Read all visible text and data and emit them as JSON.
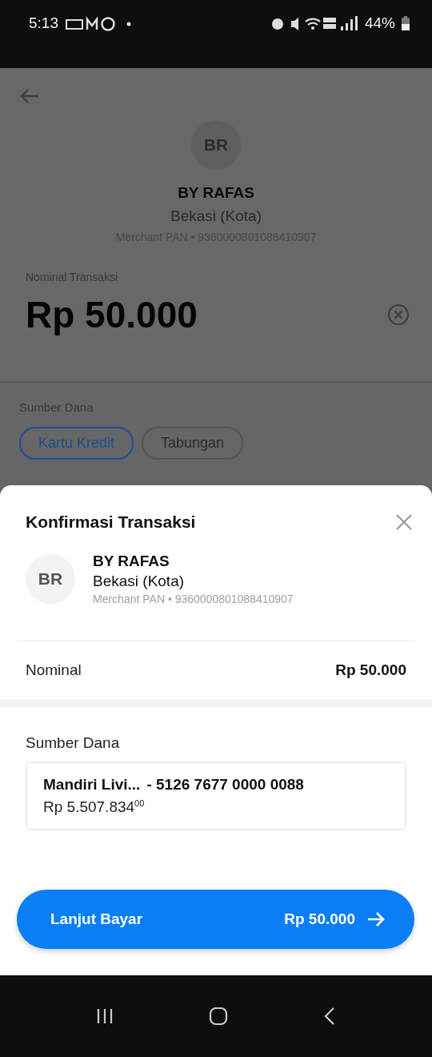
{
  "status_bar": {
    "time": "5:13",
    "battery": "44%"
  },
  "background_page": {
    "merchant": {
      "initials": "BR",
      "name": "BY RAFAS",
      "city": "Bekasi (Kota)",
      "pan": "Merchant PAN • 9360000801088410907"
    },
    "amount_label": "Nominal Transaksi",
    "amount": "Rp 50.000",
    "source_label": "Sumber Dana",
    "source_tabs": [
      {
        "label": "Kartu Kredit",
        "selected": true
      },
      {
        "label": "Tabungan",
        "selected": false
      }
    ]
  },
  "sheet": {
    "title": "Konfirmasi Transaksi",
    "merchant": {
      "initials": "BR",
      "name": "BY RAFAS",
      "city": "Bekasi (Kota)",
      "pan": "Merchant PAN • 9360000801088410907"
    },
    "nominal_label": "Nominal",
    "nominal_value": "Rp 50.000",
    "source_label": "Sumber Dana",
    "source_card": {
      "name": "Mandiri Livi...",
      "number": "- 5126 7677 0000 0088",
      "balance": "Rp 5.507.834$^{00}$"
    },
    "pay_button": {
      "label": "Lanjut Bayar",
      "amount": "Rp 50.000"
    }
  }
}
